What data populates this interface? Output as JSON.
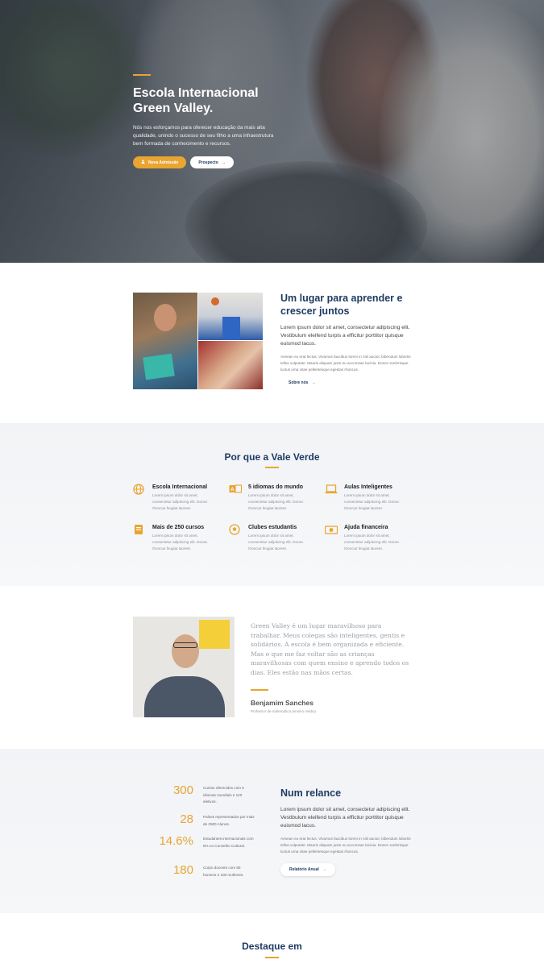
{
  "hero": {
    "title": "Escola Internacional Green Valley.",
    "text": "Nós nos esforçamos para oferecer educação da mais alta qualidade, unindo o sucesso de seu filho a uma infraestrutura bem formada de conhecimento e recursos.",
    "admission_button": "Nova Admissão",
    "prospectus_button": "Prospecto",
    "colors": {
      "accent": "#e8a531",
      "heading": "#1f3b62"
    }
  },
  "about": {
    "title": "Um lugar para aprender e crescer juntos",
    "lead": "Lorem ipsum dolor sit amet, consectetur adipiscing elit. Vestibulum eleifend turpis a efficitur porttitor quisque euismod lacus.",
    "body": "Aenean eu erat lectus. Vivamus faucibus lorem in nisl auctor, bibendum lobortis tellus vulputate. Mauris aliquam justo eu accumsan lacinia. Donec scelerisque luctus urna vitae pellentesque egestas rhoncus.",
    "link": "Sobre nós"
  },
  "why": {
    "title": "Por que a Vale Verde",
    "features": [
      {
        "icon": "globe-icon",
        "title": "Escola Internacional",
        "text": "Lorem ipsum dolor sit amet, consectetur adipiscing elit. Donec rhoncus feugiat laoreet."
      },
      {
        "icon": "language-icon",
        "title": "5 idiomas do mundo",
        "text": "Lorem ipsum dolor sit amet, consectetur adipiscing elit. Donec rhoncus feugiat laoreet."
      },
      {
        "icon": "laptop-icon",
        "title": "Aulas Inteligentes",
        "text": "Lorem ipsum dolor sit amet, consectetur adipiscing elit. Donec rhoncus feugiat laoreet."
      },
      {
        "icon": "book-icon",
        "title": "Mais de 250 cursos",
        "text": "Lorem ipsum dolor sit amet, consectetur adipiscing elit. Donec rhoncus feugiat laoreet."
      },
      {
        "icon": "football-icon",
        "title": "Clubes estudantis",
        "text": "Lorem ipsum dolor sit amet, consectetur adipiscing elit. Donec rhoncus feugiat laoreet."
      },
      {
        "icon": "money-icon",
        "title": "Ajuda financeira",
        "text": "Lorem ipsum dolor sit amet, consectetur adipiscing elit. Donec rhoncus feugiat laoreet."
      }
    ]
  },
  "testimonial": {
    "quote": "Green Valley é um lugar maravilhoso para trabalhar. Meus colegas são inteligentes, gentis e solidários. A escola é bem organizada e eficiente. Mas o que me faz voltar são as crianças maravilhosas com quem ensino e aprendo todos os dias. Eles estão nas mãos certas.",
    "name": "Benjamim Sanches",
    "role": "Professor de matemática (ensino médio)"
  },
  "glance": {
    "stats": [
      {
        "value": "300",
        "text": "Cursos oferecidos com 5 idiomas mundiais e 120 eletivos."
      },
      {
        "value": "28",
        "text": "Países representados por mais de 2500 Alunos."
      },
      {
        "value": "14.6%",
        "text": "Estudantes internacionais com 6% no Conselho Cultural."
      },
      {
        "value": "180",
        "text": "Corpo docente com 80 homens e 100 mulheres."
      }
    ],
    "title": "Num relance",
    "lead": "Lorem ipsum dolor sit amet, consectetur adipiscing elit. Vestibulum eleifend turpis a efficitur porttitor quisque euismod lacus.",
    "body": "Aenean eu erat lectus. Vivamus faucibus lorem in nisl auctor, bibendum lobortis tellus vulputate. Mauris aliquam justo eu accumsan lacinia. Donec scelerisque luctus urna vitae pellentesque egestas rhoncus.",
    "button": "Relatório Anual"
  },
  "featured": {
    "title": "Destaque em"
  }
}
